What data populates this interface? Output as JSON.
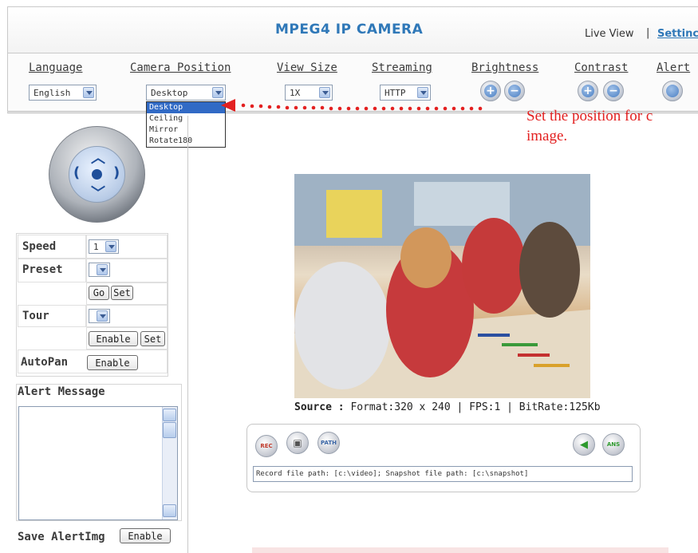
{
  "header": {
    "title": "MPEG4 IP CAMERA",
    "live_view": "Live View",
    "separator": "|",
    "settings": "Settinc"
  },
  "toolbar": {
    "language": {
      "label": "Language",
      "value": "English"
    },
    "camera_position": {
      "label": "Camera Position",
      "value": "Desktop",
      "options": [
        "Desktop",
        "Ceiling",
        "Mirror",
        "Rotate180"
      ]
    },
    "view_size": {
      "label": "View Size",
      "value": "1X"
    },
    "streaming": {
      "label": "Streaming",
      "value": "HTTP"
    },
    "brightness": {
      "label": "Brightness",
      "plus": "+",
      "minus": "−"
    },
    "contrast": {
      "label": "Contrast",
      "plus": "+",
      "minus": "−"
    },
    "alert": {
      "label": "Alert"
    }
  },
  "annotation": {
    "line1": "Set the position for c",
    "line2": "image.",
    "color": "#e32020"
  },
  "ptz": {
    "speed_label": "Speed",
    "speed_value": "1",
    "preset_label": "Preset",
    "preset_value": "",
    "go": "Go",
    "set": "Set",
    "tour_label": "Tour",
    "tour_value": "",
    "tour_enable": "Enable",
    "tour_set": "Set",
    "autopan_label": "AutoPan",
    "autopan_enable": "Enable"
  },
  "alert_panel": {
    "title": "Alert Message",
    "save_label": "Save AlertImg",
    "save_enable": "Enable"
  },
  "video": {
    "source_label": "Source :",
    "source_info": "Format:320 x 240 | FPS:1 | BitRate:125Kb",
    "rec": "REC",
    "path": "PATH",
    "ans": "ANS",
    "path_text": "Record file path: [c:\\video]; Snapshot file path: [c:\\snapshot]"
  },
  "colors": {
    "title_blue": "#2f78b8",
    "selection_blue": "#316ac5",
    "annotation_red": "#e32020"
  }
}
